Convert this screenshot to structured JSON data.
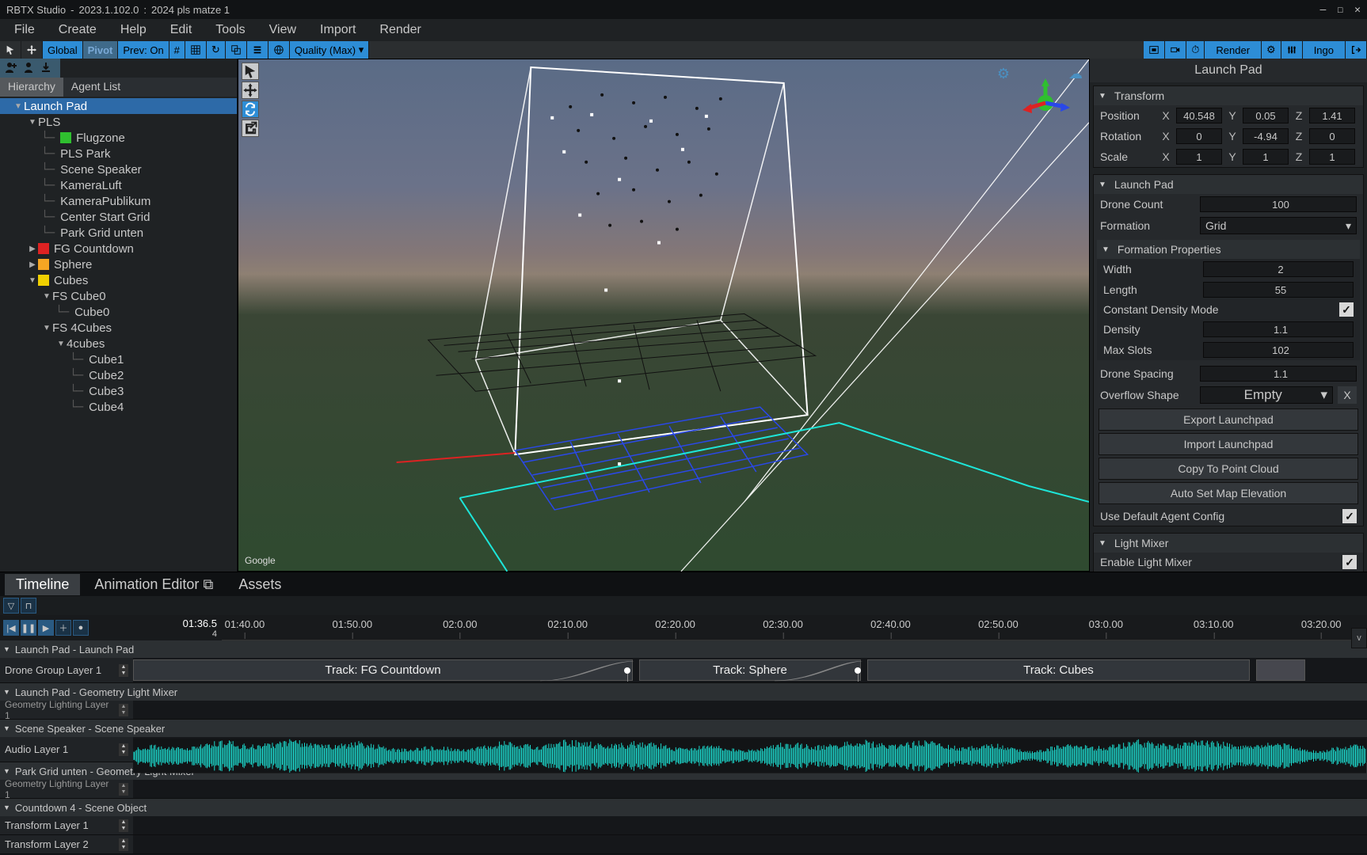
{
  "title": {
    "app": "RBTX Studio",
    "version": "2023.1.102.0",
    "project": "2024 pls matze 1"
  },
  "menubar": [
    "File",
    "Create",
    "Help",
    "Edit",
    "Tools",
    "View",
    "Import",
    "Render"
  ],
  "toolbar": {
    "global": "Global",
    "pivot": "Pivot",
    "prev": "Prev: On",
    "quality": "Quality (Max)",
    "render": "Render",
    "user": "Ingo"
  },
  "left": {
    "tabs": {
      "hierarchy": "Hierarchy",
      "agents": "Agent List"
    },
    "tree": [
      {
        "d": 0,
        "arrow": "▼",
        "label": "Launch Pad",
        "selected": true
      },
      {
        "d": 1,
        "arrow": "▼",
        "label": "PLS"
      },
      {
        "d": 2,
        "chip": "green",
        "label": "Flugzone"
      },
      {
        "d": 2,
        "label": "PLS Park"
      },
      {
        "d": 2,
        "label": "Scene Speaker"
      },
      {
        "d": 2,
        "label": "KameraLuft"
      },
      {
        "d": 2,
        "label": "KameraPublikum"
      },
      {
        "d": 2,
        "label": "Center Start Grid"
      },
      {
        "d": 2,
        "label": "Park Grid unten"
      },
      {
        "d": 1,
        "arrow": "▶",
        "chip": "red",
        "label": "FG Countdown"
      },
      {
        "d": 1,
        "arrow": "▶",
        "chip": "orange",
        "label": "Sphere"
      },
      {
        "d": 1,
        "arrow": "▼",
        "chip": "yellow",
        "label": "Cubes"
      },
      {
        "d": 2,
        "arrow": "▼",
        "label": "FS Cube0"
      },
      {
        "d": 3,
        "label": "Cube0"
      },
      {
        "d": 2,
        "arrow": "▼",
        "label": "FS 4Cubes"
      },
      {
        "d": 3,
        "arrow": "▼",
        "label": "4cubes"
      },
      {
        "d": 4,
        "label": "Cube1"
      },
      {
        "d": 4,
        "label": "Cube2"
      },
      {
        "d": 4,
        "label": "Cube3"
      },
      {
        "d": 4,
        "label": "Cube4"
      }
    ]
  },
  "viewport": {
    "attribution": "Google"
  },
  "inspector": {
    "title": "Launch Pad",
    "transform": {
      "head": "Transform",
      "position": {
        "label": "Position",
        "x": "40.548",
        "y": "0.05",
        "z": "1.41"
      },
      "rotation": {
        "label": "Rotation",
        "x": "0",
        "y": "-4.94",
        "z": "0"
      },
      "scale": {
        "label": "Scale",
        "x": "1",
        "y": "1",
        "z": "1"
      }
    },
    "launchpad": {
      "head": "Launch Pad",
      "drone_count": {
        "label": "Drone Count",
        "value": "100"
      },
      "formation": {
        "label": "Formation",
        "value": "Grid"
      },
      "formation_props_head": "Formation Properties",
      "width": {
        "label": "Width",
        "value": "2"
      },
      "length": {
        "label": "Length",
        "value": "55"
      },
      "cdm": {
        "label": "Constant Density Mode",
        "checked": true
      },
      "density": {
        "label": "Density",
        "value": "1.1"
      },
      "max_slots": {
        "label": "Max Slots",
        "value": "102"
      },
      "spacing": {
        "label": "Drone Spacing",
        "value": "1.1"
      },
      "overflow": {
        "label": "Overflow Shape",
        "value": "Empty"
      },
      "btn_export": "Export Launchpad",
      "btn_import": "Import Launchpad",
      "btn_copy": "Copy To Point Cloud",
      "btn_elev": "Auto Set Map Elevation",
      "use_default": {
        "label": "Use Default Agent Config",
        "checked": true
      }
    },
    "lightmixer": {
      "head": "Light Mixer",
      "enable": {
        "label": "Enable Light Mixer",
        "checked": true
      }
    }
  },
  "timeline": {
    "tabs": {
      "timeline": "Timeline",
      "anim": "Animation Editor",
      "assets": "Assets"
    },
    "playhead": {
      "time": "01:36.5",
      "frame": "4"
    },
    "ticks": [
      "01:40.00",
      "01:50.00",
      "02:0.00",
      "02:10.00",
      "02:20.00",
      "02:30.00",
      "02:40.00",
      "02:50.00",
      "03:0.00",
      "03:10.00",
      "03:20.00"
    ],
    "groups": {
      "g1": "Launch Pad - Launch Pad",
      "g2": "Launch Pad - Geometry Light Mixer",
      "g3": "Scene Speaker - Scene Speaker",
      "g4": "Park Grid unten - Geometry Light Mixer",
      "g5": "Countdown 4 - Scene Object"
    },
    "layers": {
      "drone": "Drone Group Layer 1",
      "geo1": "Geometry Lighting Layer 1",
      "audio": "Audio Layer 1",
      "geo2": "Geometry Lighting Layer 1",
      "tf1": "Transform Layer 1",
      "tf2": "Transform Layer 2"
    },
    "clips": {
      "c1": "Track: FG Countdown",
      "c2": "Track: Sphere",
      "c3": "Track: Cubes"
    }
  }
}
